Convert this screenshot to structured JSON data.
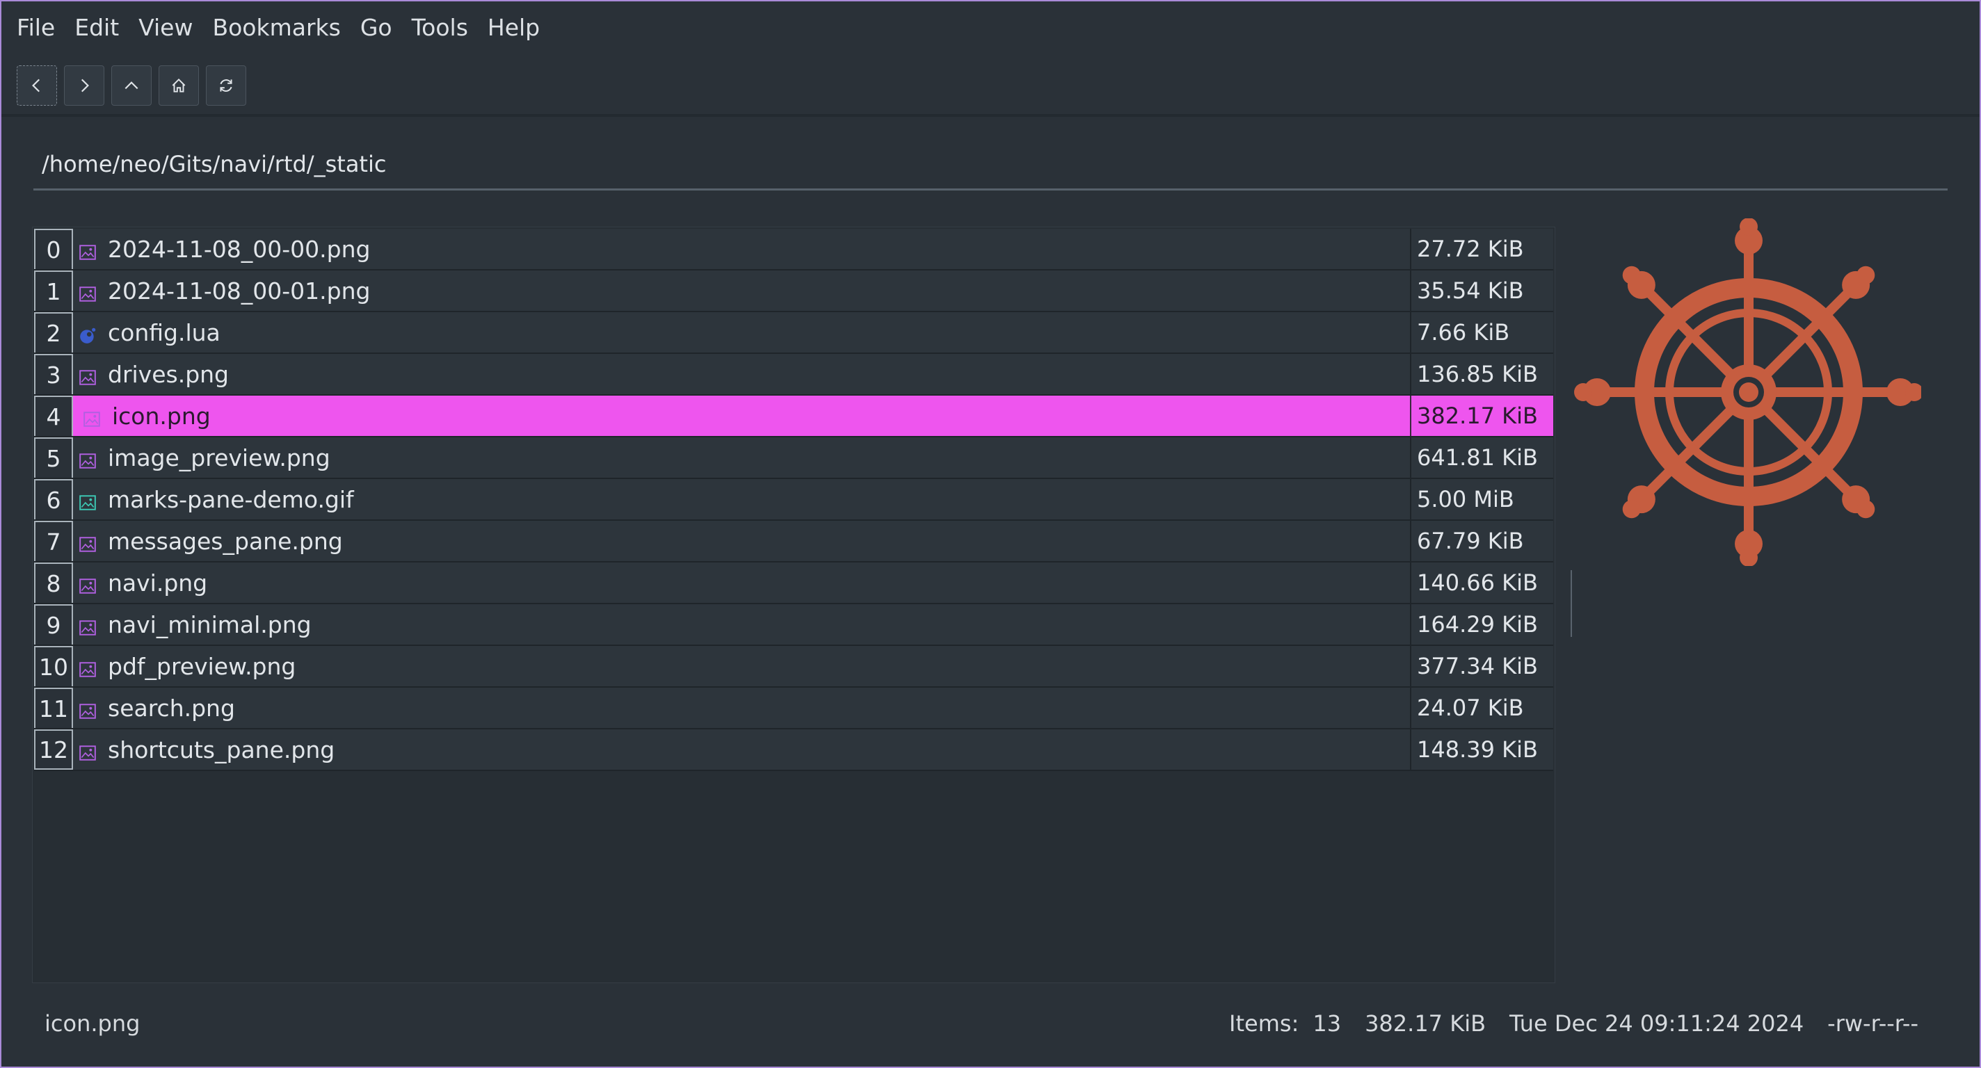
{
  "menubar": {
    "items": [
      "File",
      "Edit",
      "View",
      "Bookmarks",
      "Go",
      "Tools",
      "Help"
    ]
  },
  "toolbar": {
    "buttons": [
      "back-icon",
      "forward-icon",
      "up-icon",
      "home-icon",
      "refresh-icon"
    ]
  },
  "pathbar": {
    "value": "/home/neo/Gits/navi/rtd/_static"
  },
  "files": [
    {
      "index": "0",
      "name": "2024-11-08_00-00.png",
      "size": "27.72 KiB",
      "icon": "image-icon"
    },
    {
      "index": "1",
      "name": "2024-11-08_00-01.png",
      "size": "35.54 KiB",
      "icon": "image-icon"
    },
    {
      "index": "2",
      "name": "config.lua",
      "size": "7.66 KiB",
      "icon": "lua-icon"
    },
    {
      "index": "3",
      "name": "drives.png",
      "size": "136.85 KiB",
      "icon": "image-icon"
    },
    {
      "index": "4",
      "name": "icon.png",
      "size": "382.17 KiB",
      "icon": "image-icon",
      "selected": true
    },
    {
      "index": "5",
      "name": "image_preview.png",
      "size": "641.81 KiB",
      "icon": "image-icon"
    },
    {
      "index": "6",
      "name": "marks-pane-demo.gif",
      "size": "5.00 MiB",
      "icon": "gif-icon"
    },
    {
      "index": "7",
      "name": "messages_pane.png",
      "size": "67.79 KiB",
      "icon": "image-icon"
    },
    {
      "index": "8",
      "name": "navi.png",
      "size": "140.66 KiB",
      "icon": "image-icon"
    },
    {
      "index": "9",
      "name": "navi_minimal.png",
      "size": "164.29 KiB",
      "icon": "image-icon"
    },
    {
      "index": "10",
      "name": "pdf_preview.png",
      "size": "377.34 KiB",
      "icon": "image-icon"
    },
    {
      "index": "11",
      "name": "search.png",
      "size": "24.07 KiB",
      "icon": "image-icon"
    },
    {
      "index": "12",
      "name": "shortcuts_pane.png",
      "size": "148.39 KiB",
      "icon": "image-icon"
    }
  ],
  "preview": {
    "icon": "ship-wheel-icon",
    "color": "#c45a3e"
  },
  "statusbar": {
    "current_file": "icon.png",
    "items_label": "Items:",
    "items_count": "13",
    "size": "382.17 KiB",
    "modified": "Tue Dec 24 09:11:24 2024",
    "permissions": "-rw-r--r--"
  },
  "colors": {
    "background": "#2a3138",
    "selection": "#ee55ee",
    "window_border": "#a98ad8",
    "image_icon": "#b060e0",
    "gif_icon": "#3cc8b4",
    "lua_icon": "#3a5ccc"
  }
}
